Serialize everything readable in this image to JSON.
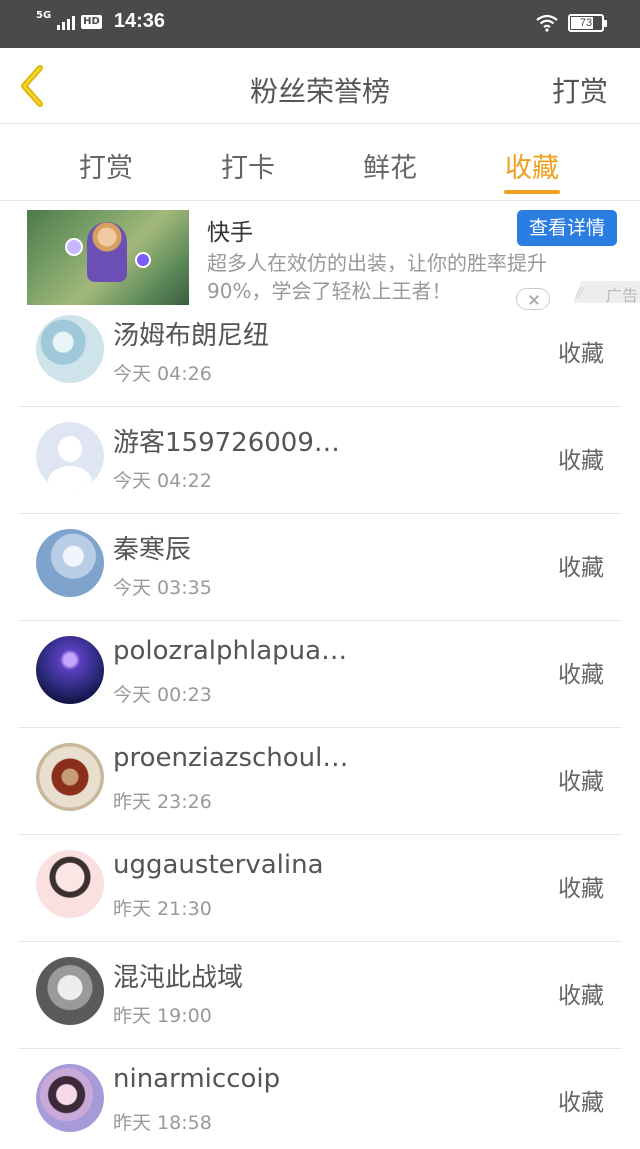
{
  "status_bar": {
    "network": "5G",
    "hd": "HD",
    "time": "14:36",
    "battery": "73"
  },
  "header": {
    "title": "粉丝荣誉榜",
    "action_label": "打赏"
  },
  "tabs": [
    {
      "label": "打赏"
    },
    {
      "label": "打卡"
    },
    {
      "label": "鲜花"
    },
    {
      "label": "收藏"
    }
  ],
  "active_tab_index": 3,
  "colors": {
    "accent": "#f0a020",
    "ad_button": "#2a7de1"
  },
  "ad": {
    "brand": "快手",
    "cta_label": "查看详情",
    "description": "超多人在效仿的出装，让你的胜率提升90%，学会了轻松上王者！",
    "label": "广告"
  },
  "list": [
    {
      "name": "汤姆布朗尼纽",
      "time": "今天 04:26",
      "action": "收藏"
    },
    {
      "name": "游客159726009…",
      "time": "今天 04:22",
      "action": "收藏"
    },
    {
      "name": "秦寒辰",
      "time": "今天 03:35",
      "action": "收藏"
    },
    {
      "name": "polozralphlapua…",
      "time": "今天 00:23",
      "action": "收藏"
    },
    {
      "name": "proenziazschoul…",
      "time": "昨天 23:26",
      "action": "收藏"
    },
    {
      "name": "uggaustervalina",
      "time": "昨天 21:30",
      "action": "收藏"
    },
    {
      "name": "混沌此战域",
      "time": "昨天 19:00",
      "action": "收藏"
    },
    {
      "name": "ninarmiccoip",
      "time": "昨天 18:58",
      "action": "收藏"
    }
  ]
}
